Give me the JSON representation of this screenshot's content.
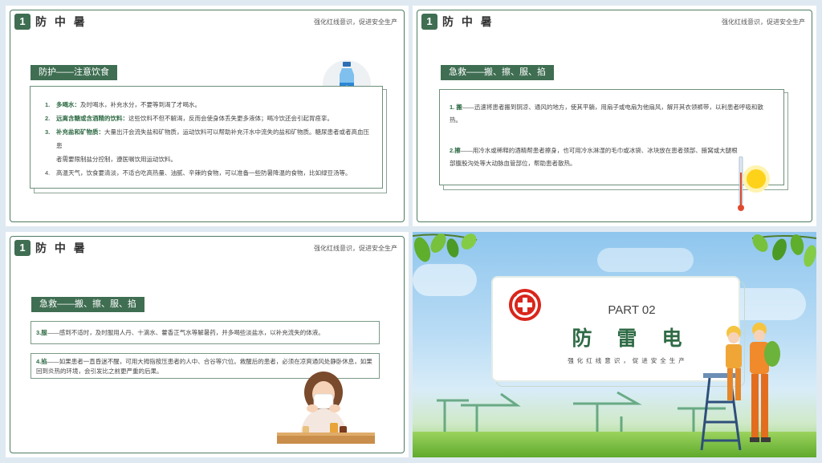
{
  "slide1": {
    "number": "1",
    "title": "防 中 暑",
    "slogan": "强化红线意识，促进安全生产",
    "tag": "防护——注意饮食",
    "items": [
      {
        "num": "1.",
        "bold": "多喝水：",
        "text": "及时喝水，补充水分，不要等到渴了才喝水。"
      },
      {
        "num": "2.",
        "bold": "远离含糖或含酒精的饮料：",
        "text": "这些饮料不但不解渴，反而会使身体丢失更多液体；喝冷饮还会引起胃痉挛。"
      },
      {
        "num": "3.",
        "bold": "补充盐和矿物质：",
        "text": "大量出汗会流失盐和矿物质，运动饮料可以帮助补充汗水中流失的盐和矿物质。糖尿患者或者高血压患"
      },
      {
        "num": "",
        "bold": "",
        "text": "者需要限制盐分控制，遵医嘱饮用运动饮料。"
      },
      {
        "num": "4.",
        "bold": "",
        "text": "高温天气，饮食要清淡，不适合吃高热量、油腻、辛辣的食物，可以准备一些防暑降温的食物，比如绿豆汤等。"
      }
    ]
  },
  "slide2": {
    "number": "1",
    "title": "防 中 暑",
    "slogan": "强化红线意识，促进安全生产",
    "tag": "急救——搬、擦、服、掐",
    "p1_bold": "1. 搬",
    "p1_text": "——迅速将患者搬到阴凉、通风的地方，使其平躺，用扇子或电扇为他扇风，解开其衣领裤带，以利患者呼吸和散热。",
    "p2_bold": "2.擦",
    "p2_text": "——用冷水或稀释的酒精帮患者擦身，也可用冷水淋湿的毛巾或冰袋、冰块放在患者颈部、腋窝或大腿根部腹股沟处等大动脉血管部位，帮助患者散热。"
  },
  "slide3": {
    "number": "1",
    "title": "防 中 暑",
    "slogan": "强化红线意识，促进安全生产",
    "tag": "急救——搬、擦、服、掐",
    "p3_bold": "3.服",
    "p3_text": "——感到不适时，及时服用人丹、十滴水、藿香正气水等解暑药，并多喝些淡盐水，以补充流失的体液。",
    "p4_bold": "4.掐",
    "p4_text": "——如果患者一直昏迷不醒，可用大拇指按压患者的人中、合谷等穴位。救醒后的患者，必须在凉爽通风处静卧休息，如果回到炎热的环境，会引发比之前更严重的后果。"
  },
  "slide4": {
    "part": "PART 02",
    "title": "防 雷 电",
    "subtitle": "强化红线意识，促进安全生产"
  },
  "colors": {
    "accent": "#3f6e52",
    "safety_red": "#d9261c"
  }
}
